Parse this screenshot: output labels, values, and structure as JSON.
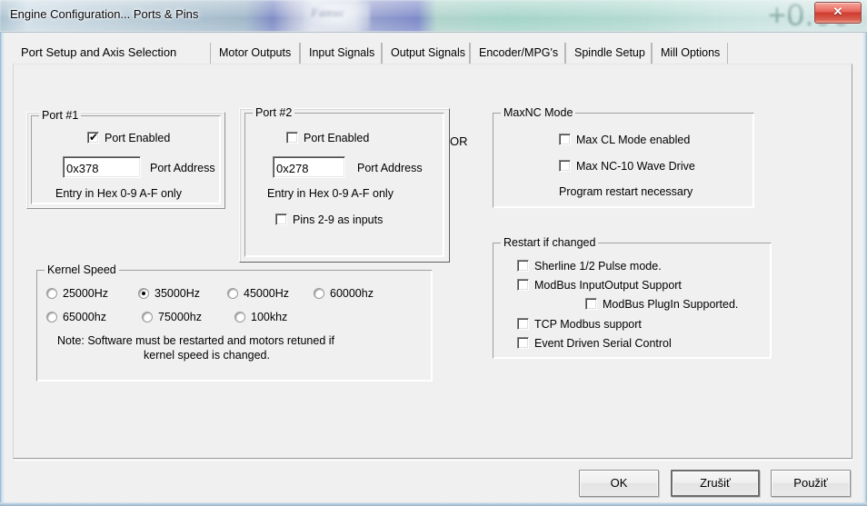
{
  "window": {
    "title": "Engine Configuration... Ports & Pins",
    "close_label": "✕",
    "ghost_text": "Fanuc",
    "ghost_number": "+0.00"
  },
  "tabs": [
    {
      "label": "Port Setup and Axis Selection",
      "active": true
    },
    {
      "label": "Motor Outputs",
      "active": false
    },
    {
      "label": "Input Signals",
      "active": false
    },
    {
      "label": "Output Signals",
      "active": false
    },
    {
      "label": "Encoder/MPG's",
      "active": false
    },
    {
      "label": "Spindle Setup",
      "active": false
    },
    {
      "label": "Mill Options",
      "active": false
    }
  ],
  "port1": {
    "title": "Port #1",
    "enabled_label": "Port Enabled",
    "enabled_checked": true,
    "address_value": "0x378",
    "address_label": "Port Address",
    "hint": "Entry in Hex 0-9 A-F only"
  },
  "port2": {
    "title": "Port #2",
    "enabled_label": "Port Enabled",
    "enabled_checked": false,
    "address_value": "0x278",
    "address_label": "Port Address",
    "hint": "Entry in Hex 0-9 A-F only",
    "pins_label": "Pins 2-9 as inputs",
    "pins_checked": false
  },
  "or_label": "OR",
  "maxnc": {
    "title": "MaxNC Mode",
    "cl_mode_label": "Max CL Mode enabled",
    "cl_mode_checked": false,
    "wave_drive_label": "Max NC-10 Wave Drive",
    "wave_drive_checked": false,
    "note": "Program restart necessary"
  },
  "restart": {
    "title": "Restart if changed",
    "items": [
      {
        "label": "Sherline 1/2 Pulse mode.",
        "checked": false,
        "indent": 0
      },
      {
        "label": "ModBus InputOutput Support",
        "checked": false,
        "indent": 0
      },
      {
        "label": "ModBus PlugIn Supported.",
        "checked": false,
        "indent": 1
      },
      {
        "label": "TCP Modbus support",
        "checked": false,
        "indent": 0
      },
      {
        "label": "Event Driven Serial Control",
        "checked": false,
        "indent": 0
      }
    ]
  },
  "kernel": {
    "title": "Kernel Speed",
    "options": [
      {
        "label": "25000Hz",
        "selected": false
      },
      {
        "label": "35000Hz",
        "selected": true
      },
      {
        "label": "45000Hz",
        "selected": false
      },
      {
        "label": "60000hz",
        "selected": false
      },
      {
        "label": "65000hz",
        "selected": false
      },
      {
        "label": "75000hz",
        "selected": false
      },
      {
        "label": "100khz",
        "selected": false
      }
    ],
    "note_line1": "Note: Software must be restarted and motors retuned if",
    "note_line2": "kernel speed is changed."
  },
  "buttons": {
    "ok": "OK",
    "cancel": "Zrušiť",
    "apply": "Použiť"
  }
}
